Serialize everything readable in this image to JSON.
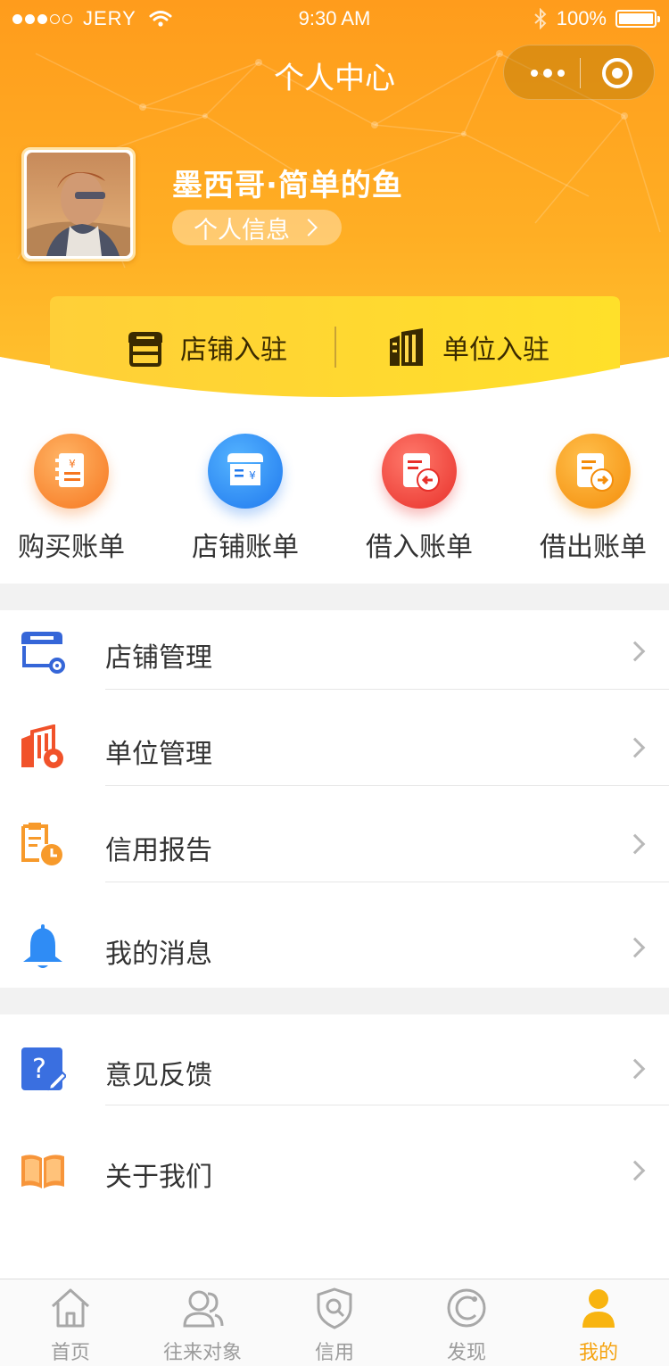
{
  "status_bar": {
    "carrier": "JERY",
    "time": "9:30 AM",
    "battery": "100%"
  },
  "header": {
    "title": "个人中心"
  },
  "profile": {
    "name": "墨西哥·简单的鱼",
    "info_button": "个人信息"
  },
  "join": {
    "shop_label": "店铺入驻",
    "unit_label": "单位入驻"
  },
  "bills": [
    {
      "label": "购买账单",
      "icon": "purchase-bill-icon",
      "color": "#f98a2a"
    },
    {
      "label": "店铺账单",
      "icon": "shop-bill-icon",
      "color": "#2d8ef3"
    },
    {
      "label": "借入账单",
      "icon": "borrow-in-bill-icon",
      "color": "#f04a3e"
    },
    {
      "label": "借出账单",
      "icon": "lend-out-bill-icon",
      "color": "#f8a21b"
    }
  ],
  "menu_group1": [
    {
      "label": "店铺管理",
      "icon": "shop-settings-icon"
    },
    {
      "label": "单位管理",
      "icon": "building-settings-icon"
    },
    {
      "label": "信用报告",
      "icon": "credit-report-icon"
    },
    {
      "label": "我的消息",
      "icon": "bell-icon"
    }
  ],
  "menu_group2": [
    {
      "label": "意见反馈",
      "icon": "feedback-icon"
    },
    {
      "label": "关于我们",
      "icon": "open-book-icon"
    }
  ],
  "tabbar": [
    {
      "label": "首页",
      "icon": "home-icon",
      "active": false
    },
    {
      "label": "往来对象",
      "icon": "contacts-icon",
      "active": false
    },
    {
      "label": "信用",
      "icon": "credit-shield-icon",
      "active": false
    },
    {
      "label": "发现",
      "icon": "discover-icon",
      "active": false
    },
    {
      "label": "我的",
      "icon": "me-icon",
      "active": true
    }
  ],
  "colors": {
    "header_gradient_top": "#ffa21a",
    "header_gradient_bottom": "#ffc22e",
    "accent": "#f5a310",
    "join_card": "#ffd84a"
  }
}
